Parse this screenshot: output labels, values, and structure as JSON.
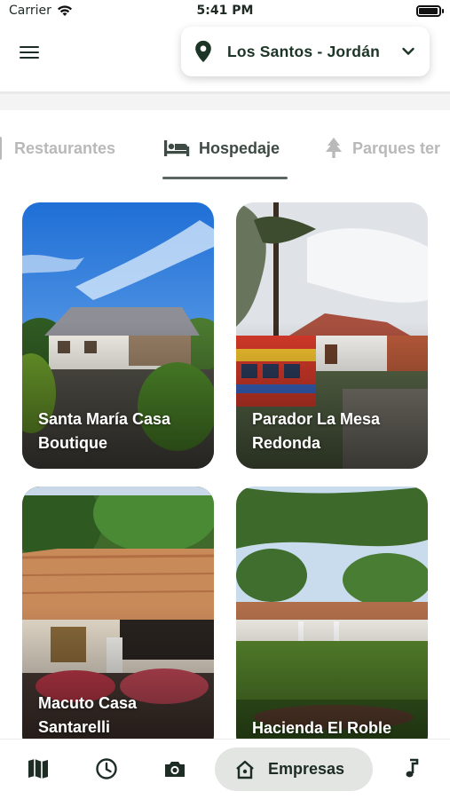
{
  "status_bar": {
    "carrier": "Carrier",
    "time": "5:41 PM",
    "battery_level": 0.95
  },
  "header": {
    "location": "Los Santos - Jordán"
  },
  "tabs": [
    {
      "label": "Restaurantes",
      "icon": "fork-knife-icon",
      "active": false
    },
    {
      "label": "Hospedaje",
      "icon": "bed-icon",
      "active": true
    },
    {
      "label": "Parques ter",
      "icon": "tree-icon",
      "active": false
    }
  ],
  "cards": [
    {
      "title": "Santa María Casa Boutique"
    },
    {
      "title": "Parador La Mesa Redonda"
    },
    {
      "title": "Macuto Casa Santarelli"
    },
    {
      "title": "Hacienda El Roble"
    }
  ],
  "bottom_nav": {
    "items": [
      {
        "icon": "map-icon"
      },
      {
        "icon": "clock-icon"
      },
      {
        "icon": "camera-icon"
      },
      {
        "icon": "music-note-icon"
      }
    ],
    "active_label": "Empresas",
    "active_icon": "home-shop-icon"
  },
  "colors": {
    "brand_dark": "#1d3526",
    "tab_inactive": "#b9b9b9",
    "pill_bg": "#e3e5e3"
  }
}
